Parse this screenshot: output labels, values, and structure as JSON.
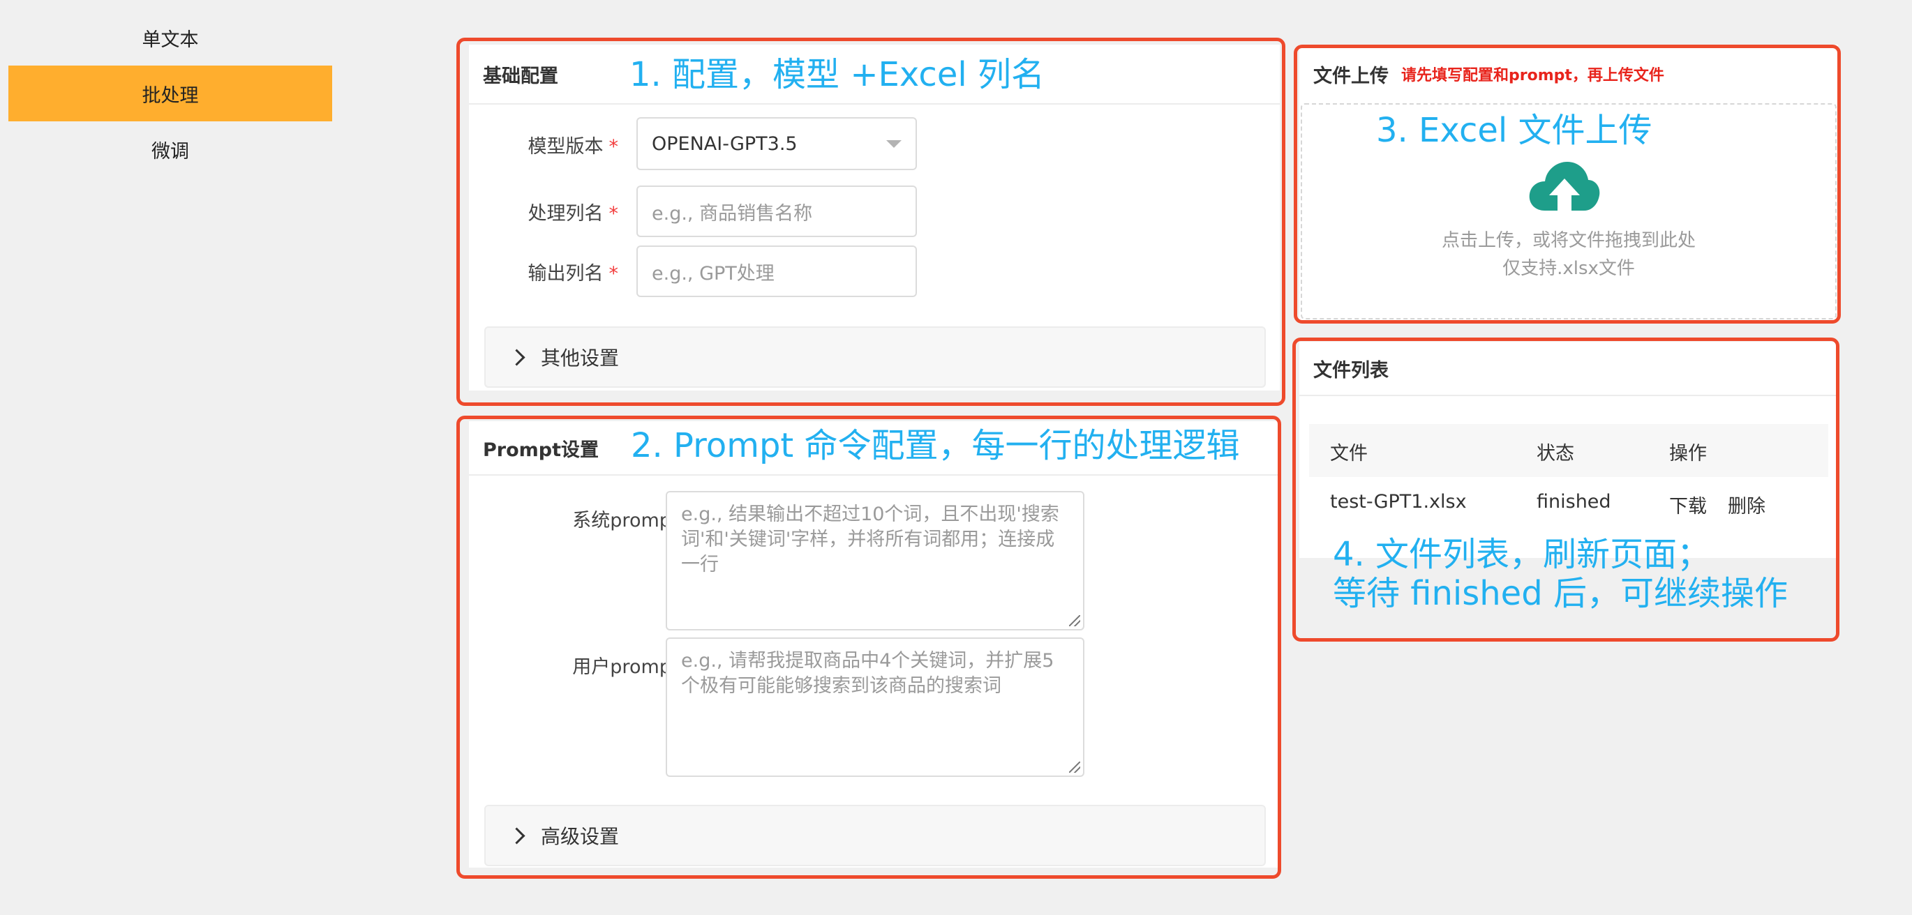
{
  "sidebar": {
    "items": [
      {
        "label": "单文本",
        "active": false
      },
      {
        "label": "批处理",
        "active": true
      },
      {
        "label": "微调",
        "active": false
      }
    ],
    "active_color": "#ffae2e"
  },
  "basic_config": {
    "title": "基础配置",
    "annotation": "1. 配置，模型 +Excel 列名",
    "model_label": "模型版本",
    "model_value": "OPENAI-GPT3.5",
    "column_label": "处理列名",
    "column_placeholder": "e.g., 商品销售名称",
    "output_label": "输出列名",
    "output_placeholder": "e.g., GPT处理",
    "required_mark": "*",
    "other_settings": "其他设置"
  },
  "prompt_config": {
    "title": "Prompt设置",
    "annotation": "2. Prompt 命令配置，每一行的处理逻辑",
    "system_label": "系统prompt",
    "system_placeholder": "e.g., 结果输出不超过10个词，且不出现'搜索词'和'关键词'字样，并将所有词都用；连接成一行",
    "user_label": "用户prompt",
    "user_placeholder": "e.g., 请帮我提取商品中4个关键词，并扩展5个极有可能能够搜索到该商品的搜索词",
    "required_mark": "*",
    "advanced_settings": "高级设置"
  },
  "upload": {
    "title": "文件上传",
    "hint": "请先填写配置和prompt，再上传文件",
    "annotation": "3. Excel 文件上传",
    "icon": "cloud-upload-icon",
    "icon_color": "#1e9e8a",
    "drop_text": "点击上传，或将文件拖拽到此处",
    "format_text": "仅支持.xlsx文件"
  },
  "file_list": {
    "title": "文件列表",
    "columns": [
      "文件",
      "状态",
      "操作"
    ],
    "rows": [
      {
        "file": "test-GPT1.xlsx",
        "status": "finished",
        "download": "下载",
        "delete": "删除"
      }
    ],
    "annotation_line1": "4. 文件列表，刷新页面；",
    "annotation_line2": "等待 finished 后，可继续操作"
  },
  "colors": {
    "annotation_frame": "#ee4a2c",
    "annotation_text": "#22b0f0",
    "hint_red": "#e8241c"
  }
}
